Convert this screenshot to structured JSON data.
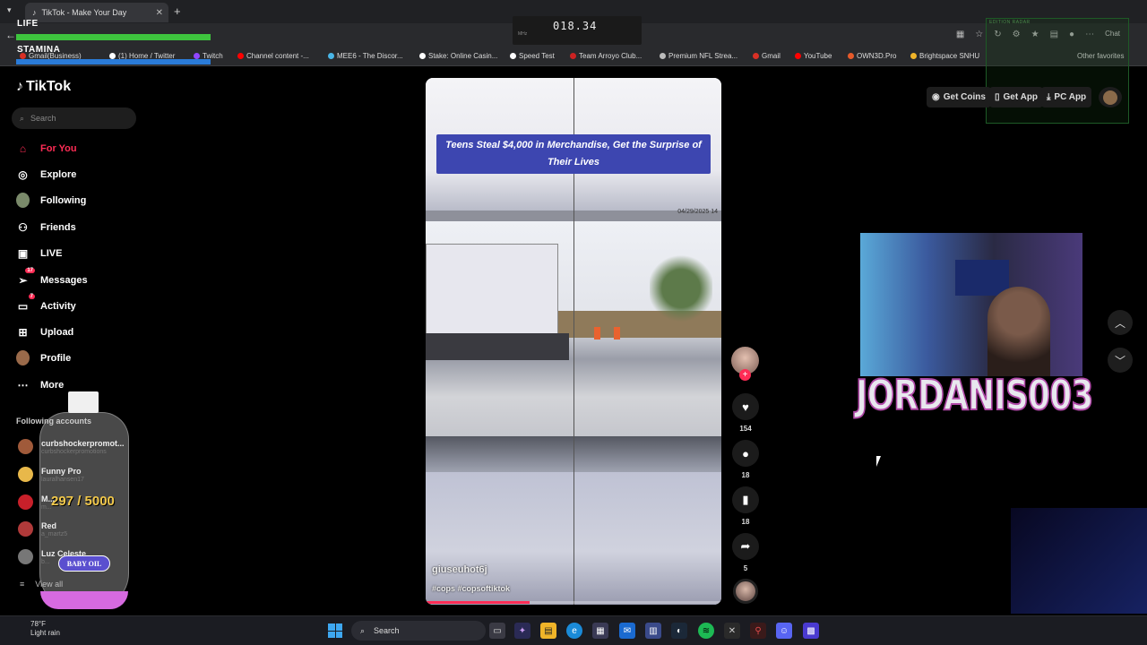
{
  "browser": {
    "tab_title": "TikTok - Make Your Day",
    "tab_close": "✕",
    "new_tab": "+",
    "chat_label": "Chat",
    "other_favorites": "Other favorites",
    "bookmarks": [
      {
        "label": "Gmail(Business)",
        "color": "#d93025"
      },
      {
        "label": "(1) Home / Twitter",
        "color": "#ffffff"
      },
      {
        "label": "Twitch",
        "color": "#9146ff"
      },
      {
        "label": "Channel content -...",
        "color": "#ff0000"
      },
      {
        "label": "MEE6 - The Discor...",
        "color": "#49b6e8"
      },
      {
        "label": "Stake: Online Casin...",
        "color": "#ffffff"
      },
      {
        "label": "Speed Test",
        "color": "#ffffff"
      },
      {
        "label": "Team Arroyo Club...",
        "color": "#cc2222"
      },
      {
        "label": "Premium NFL Strea...",
        "color": "#bbbbbb"
      },
      {
        "label": "Gmail",
        "color": "#d93025"
      },
      {
        "label": "YouTube",
        "color": "#ff0000"
      },
      {
        "label": "OWN3D.Pro",
        "color": "#e65a2a"
      },
      {
        "label": "Brightspace SNHU",
        "color": "#f0b429"
      }
    ]
  },
  "overlay": {
    "life_label": "LIFE",
    "stamina_label": "STAMINA",
    "timer": "018.34",
    "timer_sub": "MHz",
    "edition_title": "EDITION RADAR",
    "bottle_count": "297 / 5000",
    "bottle_label": "BABY OIL",
    "streamer_name": "JORDANIS003"
  },
  "tiktok": {
    "logo": "TikTok",
    "search_placeholder": "Search",
    "nav": [
      {
        "label": "For You",
        "icon": "home-icon",
        "active": true
      },
      {
        "label": "Explore",
        "icon": "compass-icon"
      },
      {
        "label": "Following",
        "icon": "following-avatar-icon"
      },
      {
        "label": "Friends",
        "icon": "friends-icon"
      },
      {
        "label": "LIVE",
        "icon": "live-icon"
      },
      {
        "label": "Messages",
        "icon": "messages-icon",
        "badge": "17"
      },
      {
        "label": "Activity",
        "icon": "activity-icon",
        "badge": "7"
      },
      {
        "label": "Upload",
        "icon": "upload-icon"
      },
      {
        "label": "Profile",
        "icon": "profile-avatar-icon"
      },
      {
        "label": "More",
        "icon": "more-icon"
      }
    ],
    "following_accounts_title": "Following accounts",
    "accounts": [
      {
        "name": "curbshockerpromot...",
        "handle": "curbshockerpromotions",
        "color": "#a05a3a"
      },
      {
        "name": "Funny Pro",
        "handle": "lauralhansen17",
        "color": "#e8b84a"
      },
      {
        "name": "M...",
        "handle": "m...",
        "color": "#c8202a"
      },
      {
        "name": "Red",
        "handle": "a_martz5",
        "color": "#b03a3a"
      },
      {
        "name": "Luz Celeste",
        "handle": "b...",
        "color": "#777777"
      }
    ],
    "view_all": "View all",
    "top_buttons": {
      "get_coins": "Get Coins",
      "get_app": "Get App",
      "pc_app": "PC App"
    }
  },
  "video": {
    "caption": "Teens Steal $4,000 in Merchandise, Get the Surprise of Their Lives",
    "date_stamp": "04/29/2025 14",
    "username": "giuseuhot6j",
    "tags": "#cops #copsoftiktok",
    "progress": 0.35
  },
  "actions": {
    "likes": "154",
    "comments": "18",
    "saves": "18",
    "shares": "5"
  },
  "taskbar": {
    "temperature": "78°F",
    "weather": "Light rain",
    "search": "Search"
  }
}
